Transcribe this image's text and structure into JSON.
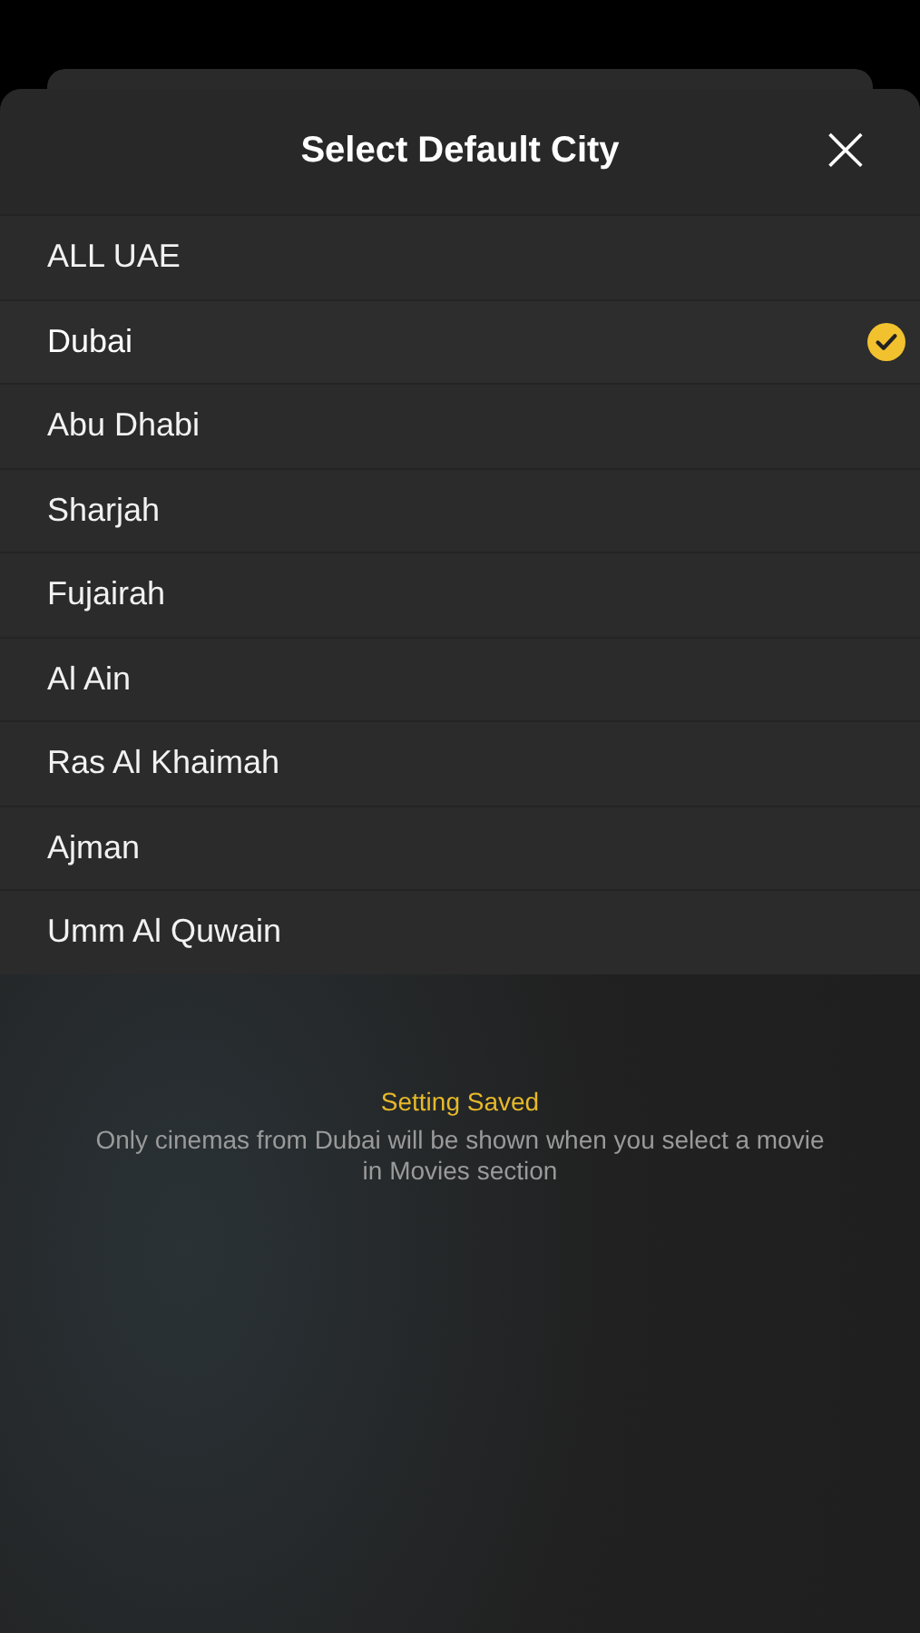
{
  "sheet": {
    "title": "Select Default City",
    "close": "×"
  },
  "cities": [
    {
      "name": "ALL UAE",
      "selected": false
    },
    {
      "name": "Dubai",
      "selected": true
    },
    {
      "name": "Abu Dhabi",
      "selected": false
    },
    {
      "name": "Sharjah",
      "selected": false
    },
    {
      "name": "Fujairah",
      "selected": false
    },
    {
      "name": "Al Ain",
      "selected": false
    },
    {
      "name": "Ras Al Khaimah",
      "selected": false
    },
    {
      "name": "Ajman",
      "selected": false
    },
    {
      "name": "Umm Al Quwain",
      "selected": false
    }
  ],
  "notice": {
    "title": "Setting Saved",
    "message": "Only cinemas from Dubai will be shown when you select a movie in Movies section"
  }
}
